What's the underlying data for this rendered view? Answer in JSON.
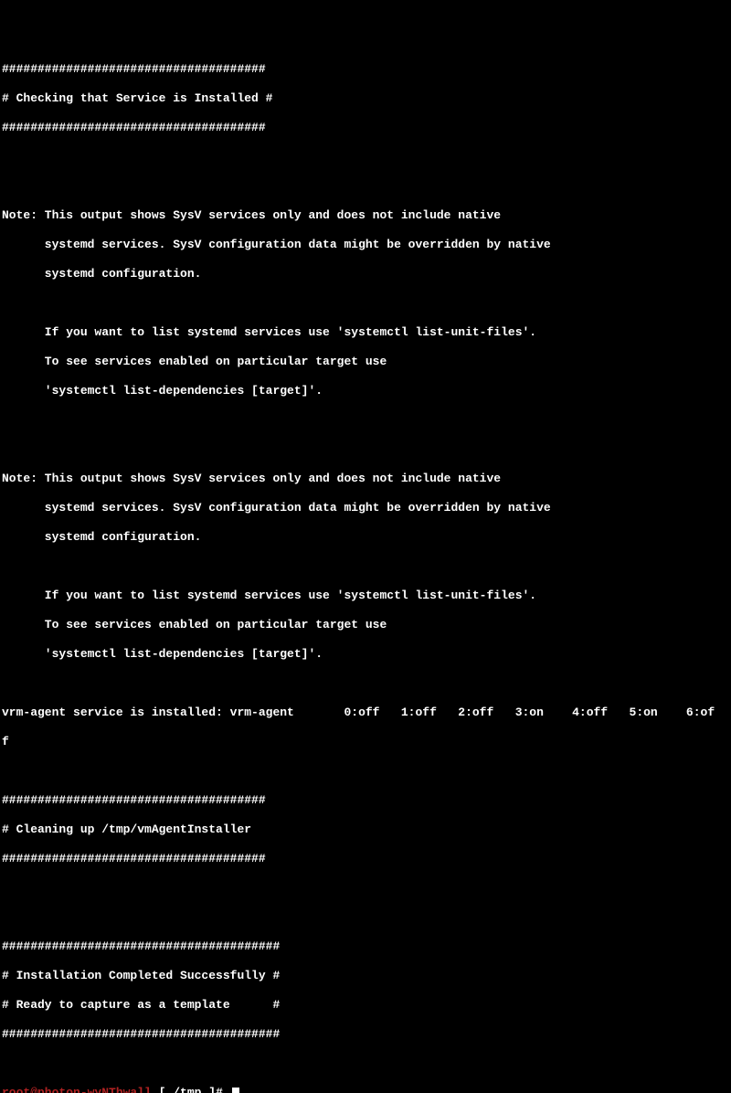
{
  "section_checking": {
    "border": "#####################################",
    "title": "# Checking that Service is Installed #"
  },
  "note_block": {
    "l1": "Note: This output shows SysV services only and does not include native",
    "l2": "      systemd services. SysV configuration data might be overridden by native",
    "l3": "      systemd configuration.",
    "l4": "      If you want to list systemd services use 'systemctl list-unit-files'.",
    "l5": "      To see services enabled on particular target use",
    "l6": "      'systemctl list-dependencies [target]'."
  },
  "service_status": {
    "line": "vrm-agent service is installed: vrm-agent       0:off   1:off   2:off   3:on    4:off   5:on    6:of",
    "wrap": "f"
  },
  "section_cleaning": {
    "border": "#####################################",
    "title": "# Cleaning up /tmp/vmAgentInstaller"
  },
  "section_done": {
    "border": "#######################################",
    "title1": "# Installation Completed Successfully #",
    "title2": "# Ready to capture as a template      #"
  },
  "prompt": {
    "user_host": "root@photon-wyNThwall",
    "path_segment": " [ /tmp ]# "
  }
}
